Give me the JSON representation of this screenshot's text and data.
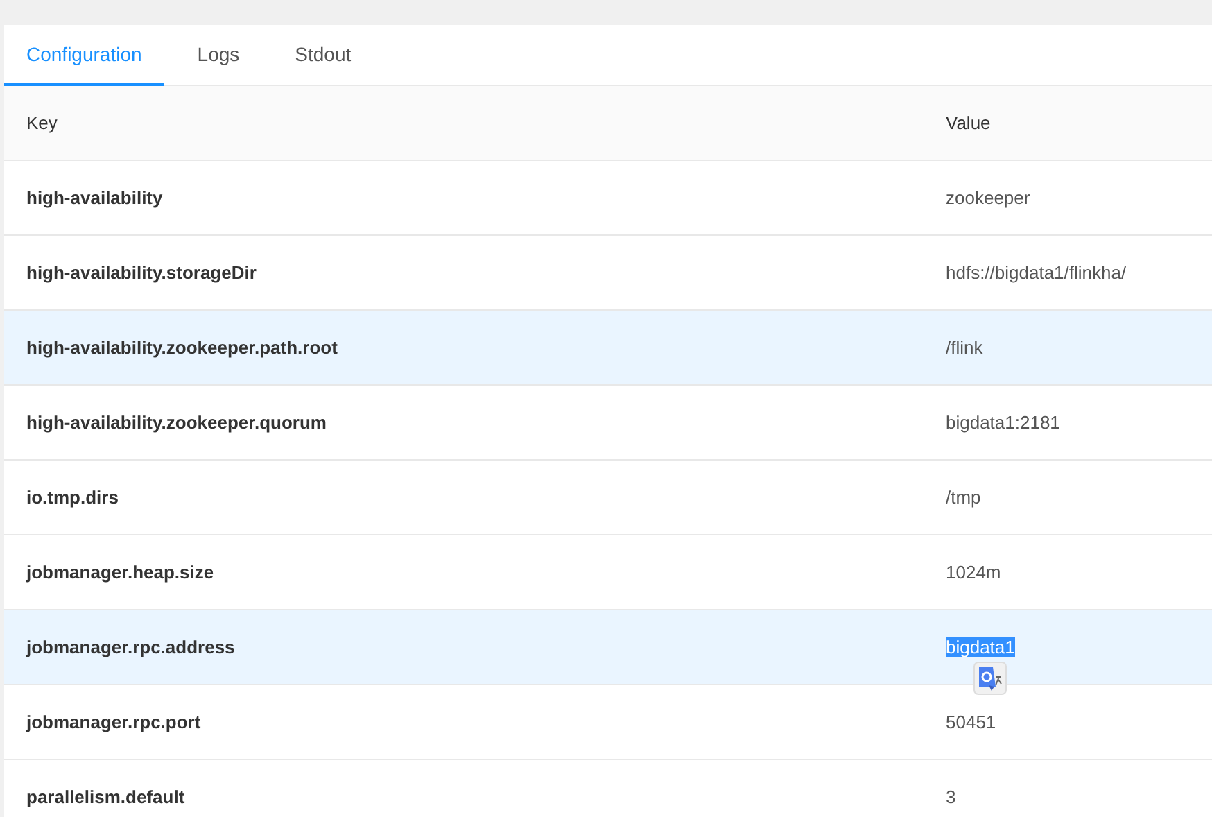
{
  "tabs": [
    {
      "label": "Configuration",
      "selected": true
    },
    {
      "label": "Logs",
      "selected": false
    },
    {
      "label": "Stdout",
      "selected": false
    }
  ],
  "table": {
    "columns": [
      "Key",
      "Value"
    ],
    "rows": [
      {
        "key": "high-availability",
        "value": "zookeeper",
        "highlighted": false,
        "text_selected": false
      },
      {
        "key": "high-availability.storageDir",
        "value": "hdfs://bigdata1/flinkha/",
        "highlighted": false,
        "text_selected": false
      },
      {
        "key": "high-availability.zookeeper.path.root",
        "value": "/flink",
        "highlighted": true,
        "text_selected": false
      },
      {
        "key": "high-availability.zookeeper.quorum",
        "value": "bigdata1:2181",
        "highlighted": false,
        "text_selected": false
      },
      {
        "key": "io.tmp.dirs",
        "value": "/tmp",
        "highlighted": false,
        "text_selected": false
      },
      {
        "key": "jobmanager.heap.size",
        "value": "1024m",
        "highlighted": false,
        "text_selected": false
      },
      {
        "key": "jobmanager.rpc.address",
        "value": "bigdata1",
        "highlighted": true,
        "text_selected": true
      },
      {
        "key": "jobmanager.rpc.port",
        "value": "50451",
        "highlighted": false,
        "text_selected": false
      },
      {
        "key": "parallelism.default",
        "value": "3",
        "highlighted": false,
        "text_selected": false
      }
    ]
  }
}
